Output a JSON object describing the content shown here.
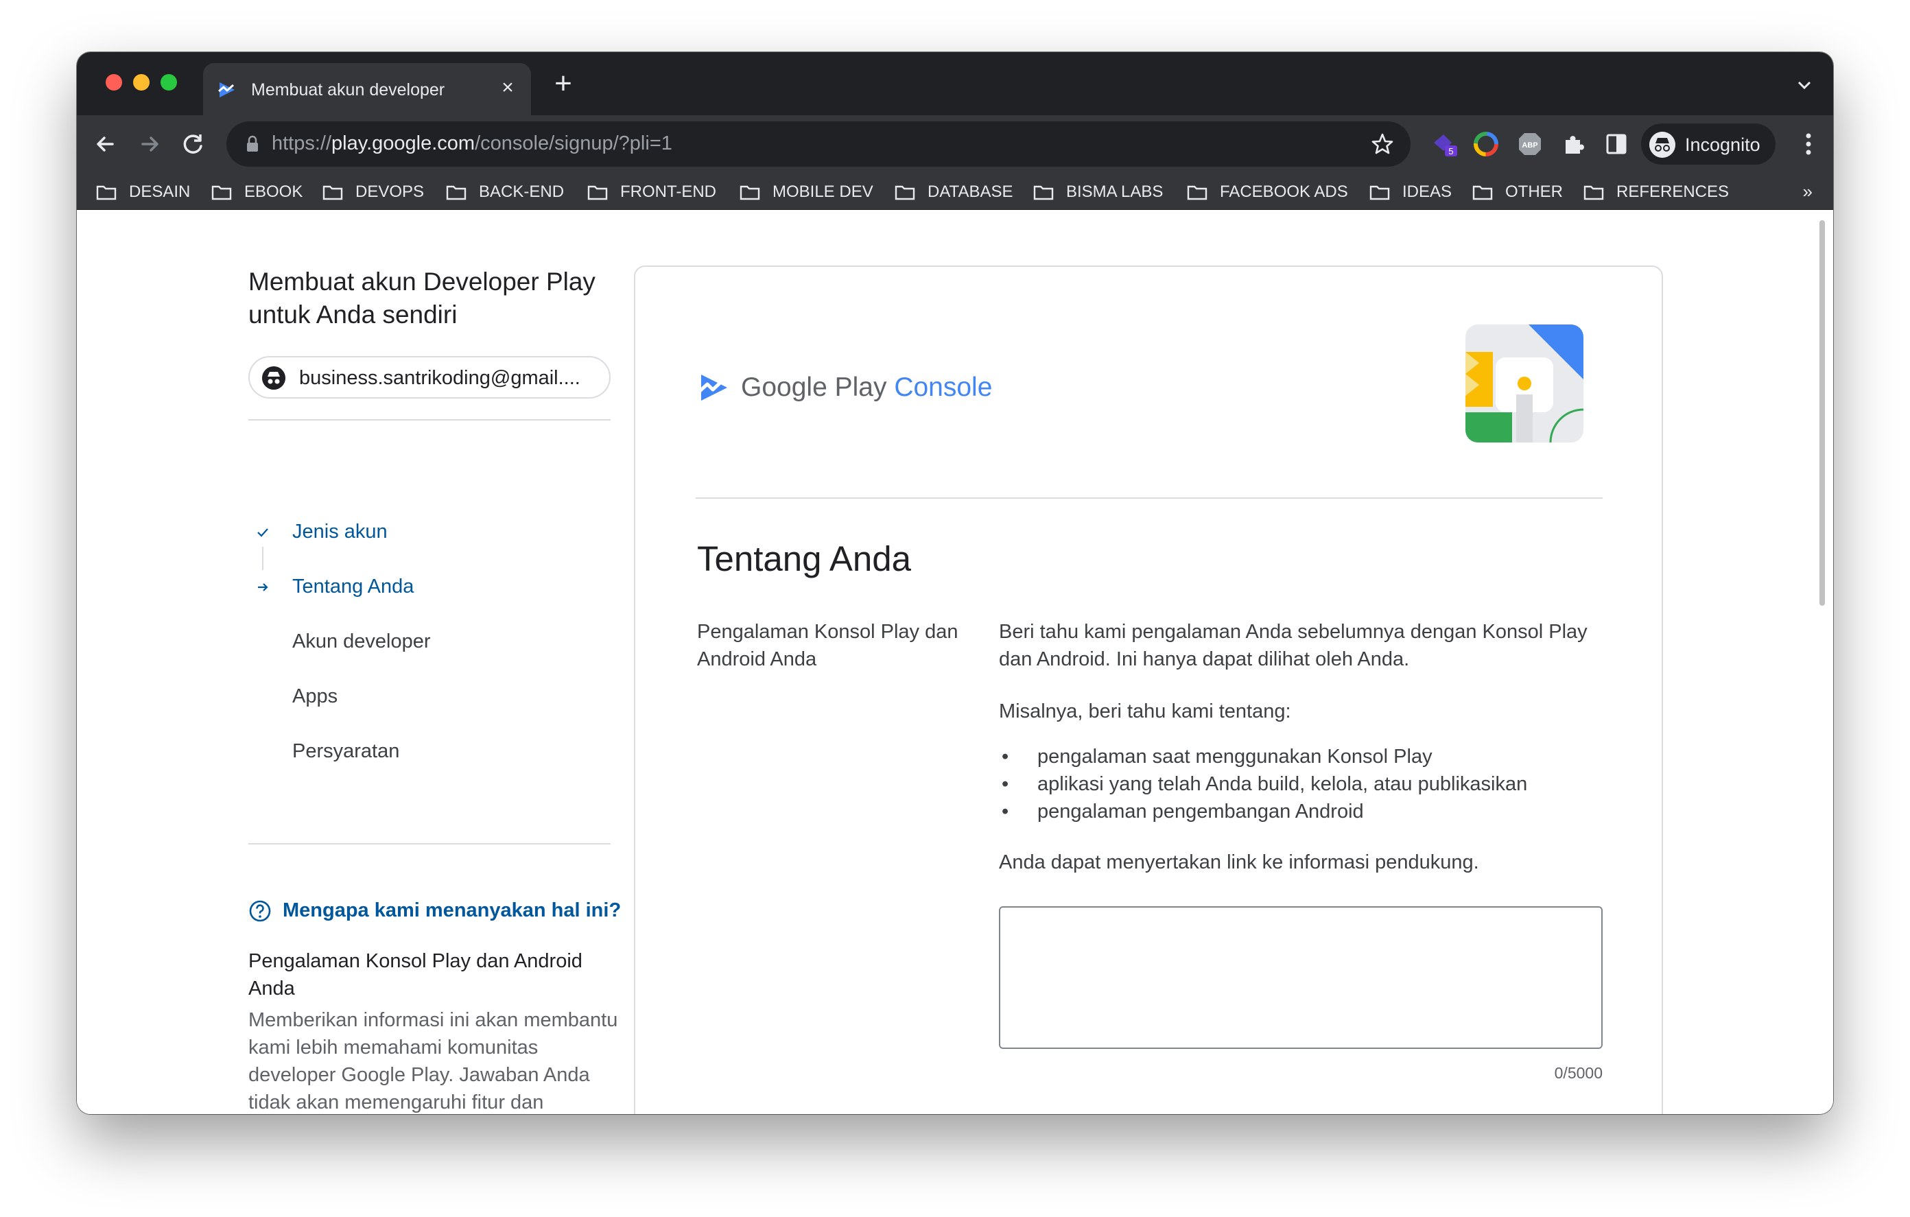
{
  "browser": {
    "tab_title": "Membuat akun developer",
    "tab_close": "×",
    "new_tab": "+",
    "url_scheme": "https://",
    "url_host": "play.google.com",
    "url_path": "/console/signup/?pli=1",
    "incognito_label": "Incognito",
    "extension_badge": "5",
    "bookmarks": [
      "DESAIN",
      "EBOOK",
      "DEVOPS",
      "BACK-END",
      "FRONT-END",
      "MOBILE DEV",
      "DATABASE",
      "BISMA LABS",
      "FACEBOOK ADS",
      "IDEAS",
      "OTHER",
      "REFERENCES"
    ],
    "bookmarks_more": "»"
  },
  "sidebar": {
    "title": "Membuat akun Developer Play untuk Anda sendiri",
    "account_email": "business.santrikoding@gmail....",
    "steps": [
      {
        "label": "Jenis akun",
        "state": "done"
      },
      {
        "label": "Tentang Anda",
        "state": "current"
      },
      {
        "label": "Akun developer",
        "state": "pending"
      },
      {
        "label": "Apps",
        "state": "pending"
      },
      {
        "label": "Persyaratan",
        "state": "pending"
      }
    ],
    "help_link": "Mengapa kami menanyakan hal ini?",
    "help_title": "Pengalaman Konsol Play dan Android Anda",
    "help_body": "Memberikan informasi ini akan membantu kami lebih memahami komunitas developer Google Play. Jawaban Anda tidak akan memengaruhi fitur dan layanan yang dapat Anda akses"
  },
  "main": {
    "logo_google_play": "Google Play ",
    "logo_console": "Console",
    "heading": "Tentang Anda",
    "field_label": "Pengalaman Konsol Play dan Android Anda",
    "description": "Beri tahu kami pengalaman Anda sebelumnya dengan Konsol Play dan Android. Ini hanya dapat dilihat oleh Anda.",
    "example_intro": "Misalnya, beri tahu kami tentang:",
    "bullets": [
      "pengalaman saat menggunakan Konsol Play",
      "aplikasi yang telah Anda build, kelola, atau publikasikan",
      "pengalaman pengembangan Android"
    ],
    "support_note": "Anda dapat menyertakan link ke informasi pendukung.",
    "textarea_value": "",
    "char_counter": "0/5000"
  },
  "colors": {
    "link_blue": "#01579b",
    "console_blue": "#4285f4",
    "chrome_dark": "#202124",
    "chrome_toolbar": "#35363a"
  }
}
